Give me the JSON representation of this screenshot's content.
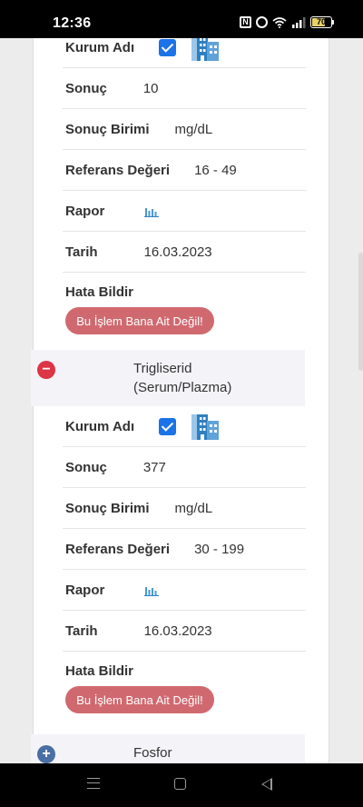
{
  "status_bar": {
    "time": "12:36",
    "nfc_label": "N",
    "battery_level": "70",
    "battery_fill_percent": 70,
    "icons": [
      "nfc-icon",
      "alarm-icon",
      "wifi-icon",
      "signal-icon",
      "battery-icon"
    ]
  },
  "colors": {
    "accent": "#1a73e8",
    "danger": "#dc3545",
    "error_button": "#d0696f",
    "expand": "#4a6fa5"
  },
  "record1": {
    "kurum_label": "Kurum Adı",
    "kurum_checked": true,
    "sonuc_label": "Sonuç",
    "sonuc_value": "10",
    "birim_label": "Sonuç Birimi",
    "birim_value": "mg/dL",
    "referans_label": "Referans Değeri",
    "referans_value": "16 - 49",
    "rapor_label": "Rapor",
    "tarih_label": "Tarih",
    "tarih_value": "16.03.2023",
    "hata_label": "Hata Bildir",
    "hata_button": "Bu İşlem Bana Ait Değil!"
  },
  "group2": {
    "toggle": "−",
    "title_line1": "Trigliserid",
    "title_line2": "(Serum/Plazma)",
    "expanded": true
  },
  "record2": {
    "kurum_label": "Kurum Adı",
    "kurum_checked": true,
    "sonuc_label": "Sonuç",
    "sonuc_value": "377",
    "birim_label": "Sonuç Birimi",
    "birim_value": "mg/dL",
    "referans_label": "Referans Değeri",
    "referans_value": "30 - 199",
    "rapor_label": "Rapor",
    "tarih_label": "Tarih",
    "tarih_value": "16.03.2023",
    "hata_label": "Hata Bildir",
    "hata_button": "Bu İşlem Bana Ait Değil!"
  },
  "group3": {
    "toggle": "+",
    "title": "Fosfor",
    "expanded": false
  },
  "nav": {
    "icons": [
      "menu-icon",
      "home-icon",
      "back-icon"
    ]
  }
}
